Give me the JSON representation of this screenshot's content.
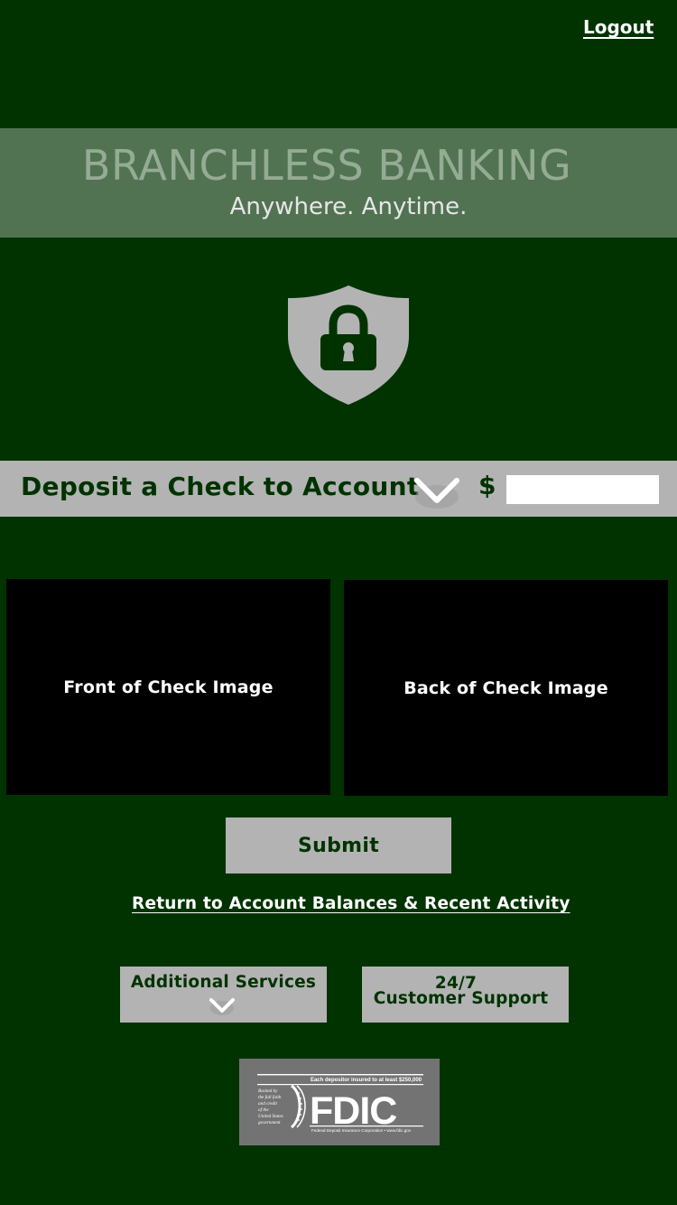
{
  "header": {
    "logout_label": "Logout"
  },
  "banner": {
    "title": "BRANCHLESS BANKING",
    "tagline": "Anywhere.  Anytime."
  },
  "security": {
    "icon": "shield-lock-icon"
  },
  "deposit": {
    "label": "Deposit a Check to Account",
    "currency_symbol": "$",
    "amount_value": "",
    "amount_placeholder": ""
  },
  "checks": {
    "front_label": "Front of Check Image",
    "back_label": "Back of Check Image"
  },
  "actions": {
    "submit_label": "Submit",
    "return_link": "Return to Account Balances & Recent Activity",
    "services_label": "Additional Services",
    "support_line1": "24/7",
    "support_line2": "Customer Support"
  },
  "fdic": {
    "insured_text": "Each depositor insured to at least $250,000",
    "backed_text": [
      "Backed by",
      "the full faith",
      "and credit",
      "of the",
      "United States",
      "government"
    ],
    "logo_text": "FDIC",
    "footer_text": "Federal Deposit Insurance Corporation • www.fdic.gov"
  },
  "colors": {
    "background": "#003300",
    "banner": "#527352",
    "panel": "#b3b3b3",
    "accent_text": "#003300"
  }
}
